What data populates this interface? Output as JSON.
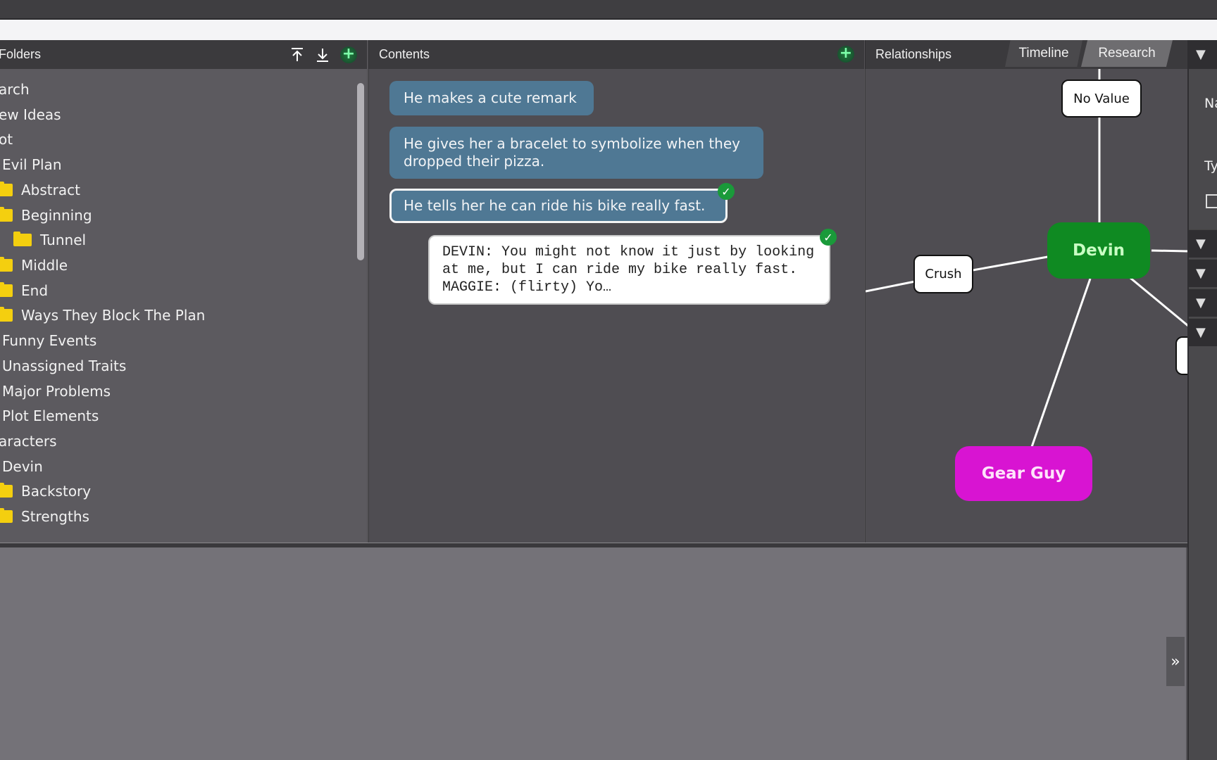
{
  "folders_panel": {
    "title": "Folders",
    "icons": [
      "collapse-all-icon",
      "expand-all-icon",
      "add-folder-icon"
    ],
    "items": [
      {
        "label": "arch",
        "level": 0,
        "folder": false
      },
      {
        "label": "ew Ideas",
        "level": 0,
        "folder": false
      },
      {
        "label": "ot",
        "level": 0,
        "folder": false
      },
      {
        "label": "Evil Plan",
        "level": 1,
        "folder": false
      },
      {
        "label": "Abstract",
        "level": 2,
        "folder": true
      },
      {
        "label": "Beginning",
        "level": 2,
        "folder": true
      },
      {
        "label": "Tunnel",
        "level": 3,
        "folder": true
      },
      {
        "label": "Middle",
        "level": 2,
        "folder": true
      },
      {
        "label": "End",
        "level": 2,
        "folder": true
      },
      {
        "label": "Ways They Block The Plan",
        "level": 2,
        "folder": true
      },
      {
        "label": "Funny Events",
        "level": 1,
        "folder": false
      },
      {
        "label": "Unassigned Traits",
        "level": 1,
        "folder": false
      },
      {
        "label": "Major Problems",
        "level": 1,
        "folder": false
      },
      {
        "label": "Plot Elements",
        "level": 1,
        "folder": false
      },
      {
        "label": "aracters",
        "level": 0,
        "folder": false
      },
      {
        "label": "Devin",
        "level": 1,
        "folder": false
      },
      {
        "label": "Backstory",
        "level": 2,
        "folder": true
      },
      {
        "label": "Strengths",
        "level": 2,
        "folder": true
      }
    ]
  },
  "contents_panel": {
    "title": "Contents",
    "cards": [
      {
        "text": "He makes a cute remark",
        "selected": false,
        "checked": false,
        "type": "note"
      },
      {
        "text": "He gives her a bracelet to symbolize when they dropped their pizza.",
        "selected": false,
        "checked": false,
        "type": "note"
      },
      {
        "text": "He tells her he can ride his bike really fast.",
        "selected": true,
        "checked": true,
        "type": "note"
      },
      {
        "text": "DEVIN:  You might not know it just by looking at me, but I can ride my bike really fast. MAGGIE:  (flirty) Yo…",
        "selected": false,
        "checked": true,
        "type": "script"
      }
    ]
  },
  "relationships_panel": {
    "title": "Relationships",
    "tabs": [
      {
        "label": "Timeline",
        "active": false
      },
      {
        "label": "Research",
        "active": true
      }
    ],
    "nodes": {
      "no_value": "No Value",
      "crush": "Crush",
      "devin": "Devin",
      "gear_guy": "Gear Guy"
    },
    "colors": {
      "devin": "#0f8a22",
      "devin_text": "#c9ffc4",
      "gear_guy": "#d814d2",
      "gear_guy_text": "#ffe3fb"
    }
  },
  "right_strip": {
    "labels": [
      "Na",
      "Ty"
    ],
    "section_arrow": "▼"
  },
  "bottom": {
    "expand_icon": "»"
  }
}
